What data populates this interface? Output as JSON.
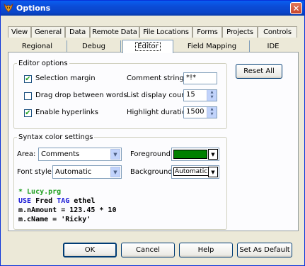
{
  "window": {
    "title": "Options"
  },
  "tabs_row1": [
    {
      "label": "View"
    },
    {
      "label": "General"
    },
    {
      "label": "Data"
    },
    {
      "label": "Remote Data"
    },
    {
      "label": "File Locations"
    },
    {
      "label": "Forms"
    },
    {
      "label": "Projects"
    },
    {
      "label": "Controls"
    }
  ],
  "tabs_row2": [
    {
      "label": "Regional"
    },
    {
      "label": "Debug"
    },
    {
      "label": "Editor",
      "active": true
    },
    {
      "label": "Field Mapping"
    },
    {
      "label": "IDE"
    }
  ],
  "editor_options": {
    "legend": "Editor options",
    "selection_margin": {
      "label": "Selection margin",
      "checked": true
    },
    "drag_drop": {
      "label": "Drag drop between words",
      "checked": false
    },
    "enable_hyperlinks": {
      "label": "Enable hyperlinks",
      "checked": true
    },
    "comment_string": {
      "label": "Comment string:",
      "value": "*!*"
    },
    "list_display_count": {
      "label": "List display count:",
      "value": "15"
    },
    "highlight_duration": {
      "label": "Highlight duration:",
      "value": "1500"
    }
  },
  "reset_all_label": "Reset All",
  "syntax": {
    "legend": "Syntax color settings",
    "area_label": "Area:",
    "area_value": "Comments",
    "font_style_label": "Font style:",
    "font_style_value": "Automatic",
    "foreground_label": "Foreground:",
    "foreground_color": "#008000",
    "background_label": "Background:",
    "background_value": "Automatic"
  },
  "code_sample": {
    "line1": "* Lucy.prg",
    "line2_kw1": "USE",
    "line2_mid": " Fred ",
    "line2_kw2": "TAG",
    "line2_end": " ethel",
    "line3": "m.nAmount = 123.45 * 10",
    "line4": "m.cName = 'Ricky'"
  },
  "buttons": {
    "ok": "OK",
    "cancel": "Cancel",
    "help": "Help",
    "set_as_default": "Set As Default"
  },
  "colors": {
    "comment_green": "#21a121",
    "keyword_blue": "#1a1ad6",
    "foreground_swatch": "#008000"
  }
}
